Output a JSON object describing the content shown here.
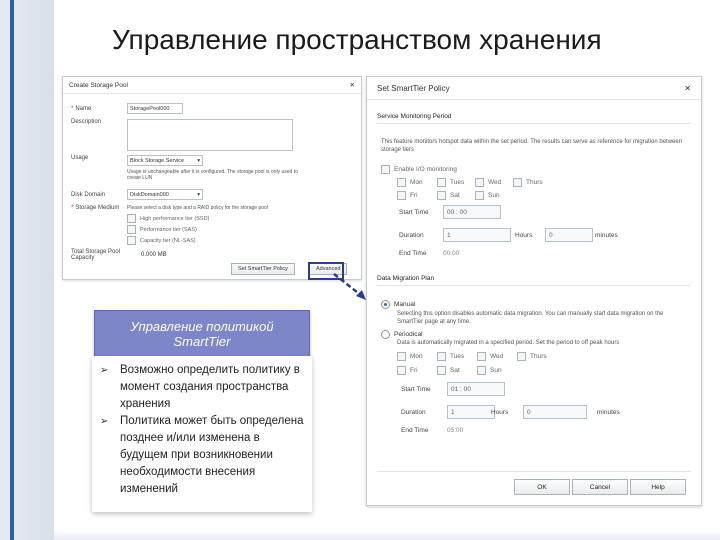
{
  "slide": {
    "title": "Управление пространством хранения"
  },
  "create_pool": {
    "title": "Create Storage Pool",
    "name_label": "Name",
    "name_value": "StoragePool000",
    "description_label": "Description",
    "usage_label": "Usage",
    "usage_value": "Block Storage Service",
    "usage_note": "Usage is unchangeable after it is configured. The storage pool is only used to",
    "usage_note2": "create LUN",
    "disk_domain_label": "Disk Domain",
    "disk_domain_value": "DiskDomain000",
    "medium_label": "Storage Medium",
    "medium_hint": "Please select a disk type and a RAID policy for the storage pool",
    "tier_high": "High performance tier (SSD)",
    "tier_perf": "Performance tier (SAS)",
    "tier_cap": "Capacity tier (NL-SAS)",
    "capacity_label": "Total Storage Pool Capacity",
    "capacity_value": "0.000 MB",
    "btn_smarttier": "Set SmartTier Policy",
    "btn_advanced": "Advanced"
  },
  "callout": {
    "line1": "Управление политикой",
    "line2": "SmartTier"
  },
  "bullets": [
    "Возможно определить политику в момент создания пространства хранения",
    "Политика может быть определена позднее и/или изменена в будущем при возникновении необходимости внесения изменений"
  ],
  "smarttier": {
    "title": "Set SmartTier Policy",
    "monitor_title": "Service Monitoring Period",
    "monitor_desc": "This feature monitors hotspot data within the set period. The results can serve as reference for migration between storage tiers",
    "enable_io": "Enable I/O monitoring",
    "days": [
      "Mon",
      "Tues",
      "Wed",
      "Thurs",
      "Fri",
      "Sat",
      "Sun"
    ],
    "start_label": "Start Time",
    "start_value": "00 : 00",
    "duration_label": "Duration",
    "hours_value": "1",
    "hours_unit": "Hours",
    "minutes_value": "0",
    "minutes_unit": "minutes",
    "end_label": "End Time",
    "end_value": "00:00",
    "migration_title": "Data Migration Plan",
    "manual": "Manual",
    "manual_desc": "Selecting this option disables automatic data migration. You can manually start data migration on the SmartTier page at any time.",
    "periodic": "Periodical",
    "periodic_desc": "Data is automatically migrated in a specified period. Set the period to off peak hours",
    "m_start_value": "01 : 00",
    "m_hours_value": "1",
    "m_minutes_value": "0",
    "m_end_value": "05:00",
    "ok": "OK",
    "cancel": "Cancel",
    "help": "Help"
  }
}
